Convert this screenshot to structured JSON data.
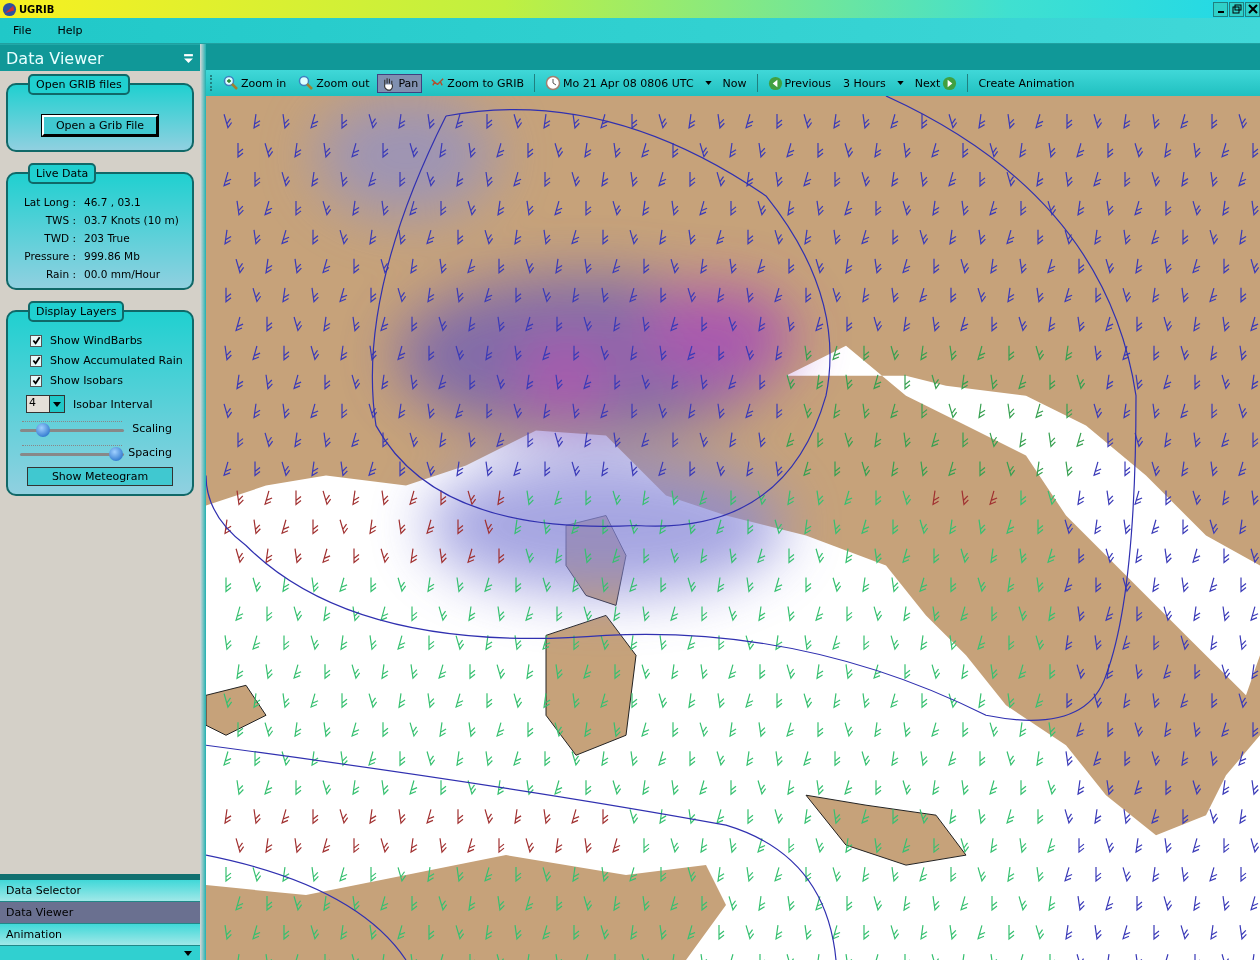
{
  "window": {
    "title": "UGRIB"
  },
  "menu": [
    "File",
    "Help"
  ],
  "sidebar": {
    "title": "Data Viewer",
    "open_grib": {
      "legend": "Open GRIB files",
      "button": "Open a Grib File"
    },
    "live_data": {
      "legend": "Live Data",
      "rows": [
        {
          "label": "Lat Long :",
          "value": "46.7 ,  03.1"
        },
        {
          "label": "TWS :",
          "value": "03.7 Knots (10 m)"
        },
        {
          "label": "TWD :",
          "value": "203 True"
        },
        {
          "label": "Pressure :",
          "value": "999.86 Mb"
        },
        {
          "label": "Rain :",
          "value": "00.0 mm/Hour"
        }
      ]
    },
    "display_layers": {
      "legend": "Display Layers",
      "checkboxes": [
        {
          "label": "Show WindBarbs",
          "checked": true
        },
        {
          "label": "Show Accumulated Rain",
          "checked": true
        },
        {
          "label": "Show Isobars",
          "checked": true
        }
      ],
      "isobar_interval": {
        "value": "4",
        "label": "Isobar Interval"
      },
      "sliders": [
        {
          "label": "Scaling",
          "level": 0.22
        },
        {
          "label": "Spacing",
          "level": 0.92
        }
      ],
      "button": "Show Meteogram"
    },
    "nav": [
      {
        "label": "Data Selector",
        "selected": false
      },
      {
        "label": "Data Viewer",
        "selected": true
      },
      {
        "label": "Animation",
        "selected": false
      }
    ]
  },
  "toolbar": [
    {
      "kind": "zoom-in",
      "label": "Zoom in",
      "selected": false
    },
    {
      "kind": "zoom-out",
      "label": "Zoom out",
      "selected": false
    },
    {
      "kind": "pan",
      "label": "Pan",
      "selected": true
    },
    {
      "kind": "extent",
      "label": "Zoom to GRIB",
      "selected": false
    },
    {
      "kind": "date",
      "label": "Mo 21 Apr 08 0806 UTC",
      "selected": false
    },
    {
      "kind": "now",
      "label": "Now",
      "selected": false
    },
    {
      "kind": "previous",
      "label": "Previous",
      "selected": false
    },
    {
      "kind": "interval",
      "label": "3 Hours",
      "selected": false
    },
    {
      "kind": "next",
      "label": "Next",
      "selected": false
    },
    {
      "kind": "action",
      "label": "Create Animation",
      "selected": false
    }
  ]
}
